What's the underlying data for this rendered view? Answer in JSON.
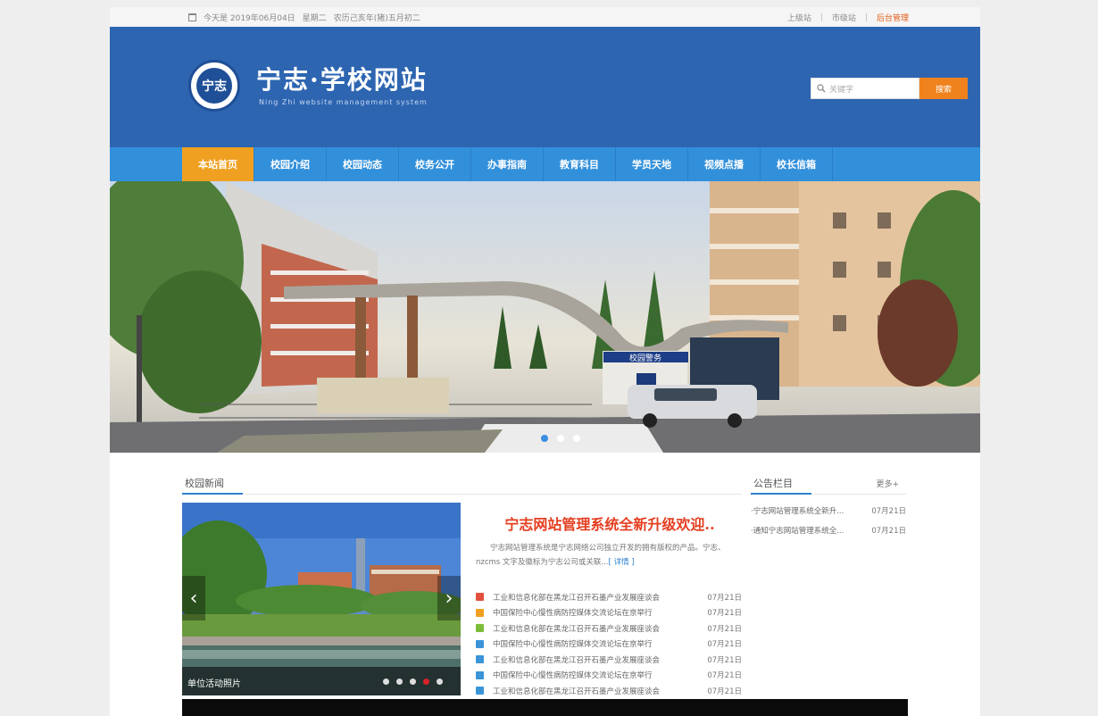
{
  "topbar": {
    "date_text": "今天是 2019年06月04日",
    "weekday": "星期二",
    "lunar": "农历己亥年(猪)五月初二",
    "links": [
      "上级站",
      "市级站"
    ],
    "admin": "后台管理",
    "separator": "|"
  },
  "header": {
    "logo_text": "宁志",
    "title": "宁志·学校网站",
    "subtitle": "Ning Zhi website management system",
    "search_placeholder": "关键字",
    "search_button": "搜索"
  },
  "nav": [
    "本站首页",
    "校园介绍",
    "校园动态",
    "校务公开",
    "办事指南",
    "教育科目",
    "学员天地",
    "视频点播",
    "校长信箱"
  ],
  "banner": {
    "gate_sign": "校园警务",
    "active_slide": 1,
    "slide_count": 3
  },
  "campus_news": {
    "heading": "校园新闻",
    "photo_caption": "单位活动照片",
    "photo_dot_count": 5,
    "photo_active_dot": 4,
    "headline": "宁志网站管理系统全新升级欢迎..",
    "summary": "宁志网站管理系统是宁志网络公司独立开发的拥有版权的产品。宁志、nzcms 文字及徽标为宁志公司或关联...",
    "detail_link": "[ 详情 ]",
    "items": [
      {
        "title": "工业和信息化部在黑龙江召开石墨产业发展座谈会",
        "date": "07月21日",
        "color": "#e0503a"
      },
      {
        "title": "中国保险中心慢性病防控媒体交流论坛在京举行",
        "date": "07月21日",
        "color": "#f0a020"
      },
      {
        "title": "工业和信息化部在黑龙江召开石墨产业发展座谈会",
        "date": "07月21日",
        "color": "#7cbc3a"
      },
      {
        "title": "中国保险中心慢性病防控媒体交流论坛在京举行",
        "date": "07月21日",
        "color": "#3a94d8"
      },
      {
        "title": "工业和信息化部在黑龙江召开石墨产业发展座谈会",
        "date": "07月21日",
        "color": "#3a94d8"
      },
      {
        "title": "中国保险中心慢性病防控媒体交流论坛在京举行",
        "date": "07月21日",
        "color": "#3a94d8"
      },
      {
        "title": "工业和信息化部在黑龙江召开石墨产业发展座谈会",
        "date": "07月21日",
        "color": "#3a94d8"
      }
    ]
  },
  "notices": {
    "heading": "公告栏目",
    "more": "更多+",
    "items": [
      {
        "title": "·宁志网站管理系统全新升...",
        "date": "07月21日"
      },
      {
        "title": "·通知宁志网站管理系统全...",
        "date": "07月21日"
      }
    ]
  },
  "colors": {
    "header_bg": "#2d65b1",
    "nav_bg": "#3290db",
    "nav_active": "#f0a020",
    "search_button": "#f0821d",
    "headline": "#e43d1f",
    "admin_link": "#e25b15"
  }
}
